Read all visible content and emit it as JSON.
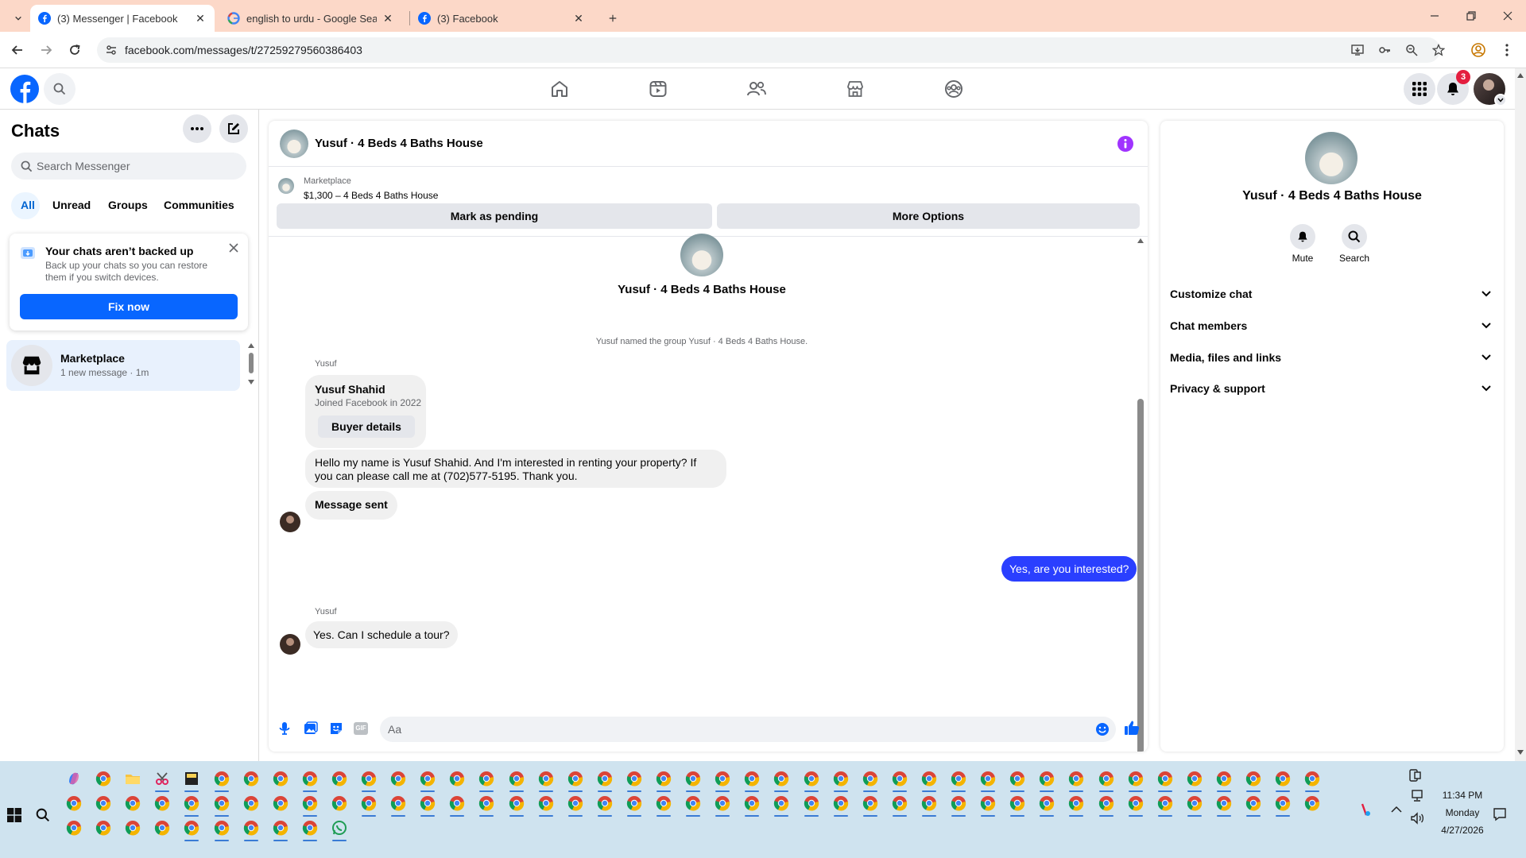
{
  "browser": {
    "tabs": [
      {
        "title": "(3) Messenger | Facebook",
        "icon": "facebook-icon",
        "active": true
      },
      {
        "title": "english to urdu - Google Search",
        "icon": "google-icon",
        "active": false
      },
      {
        "title": "(3) Facebook",
        "icon": "facebook-icon",
        "active": false
      }
    ],
    "url": "facebook.com/messages/t/27259279560386403"
  },
  "fb_header": {
    "notification_count": "3",
    "nav_icons": [
      "home-icon",
      "watch-icon",
      "friends-icon",
      "marketplace-icon",
      "groups-icon"
    ]
  },
  "sidebar": {
    "title": "Chats",
    "search_placeholder": "Search Messenger",
    "filters": [
      "All",
      "Unread",
      "Groups",
      "Communities"
    ],
    "backup": {
      "title": "Your chats aren’t backed up",
      "body": "Back up your chats so you can restore them if you switch devices.",
      "button": "Fix now"
    },
    "chats": [
      {
        "name": "Marketplace",
        "preview": "1 new message · 1m"
      }
    ]
  },
  "chat": {
    "title": "Yusuf · 4 Beds 4 Baths House",
    "listing_label": "Marketplace",
    "listing_price": "$1,300 – 4 Beds 4 Baths House",
    "pending_button": "Mark as pending",
    "more_button": "More Options",
    "group_name": "Yusuf · 4 Beds 4 Baths House",
    "system_msg": "Yusuf named the group Yusuf · 4 Beds 4 Baths House.",
    "sender_1": "Yusuf",
    "buyer_name": "Yusuf Shahid",
    "buyer_joined": "Joined Facebook in 2022",
    "buyer_button": "Buyer details",
    "msg_1": "Hello my name is Yusuf Shahid. And I'm interested in renting your property? If you can please call me at (702)577-5195. Thank you.",
    "msg_2": "Message sent",
    "msg_out": "Yes, are you interested?",
    "sender_2": "Yusuf",
    "msg_3": "Yes. Can I schedule a tour?",
    "composer_placeholder": "Aa"
  },
  "right_panel": {
    "title": "Yusuf · 4 Beds 4 Baths House",
    "mute_label": "Mute",
    "search_label": "Search",
    "sections": [
      "Customize chat",
      "Chat members",
      "Media, files and links",
      "Privacy & support"
    ]
  },
  "taskbar": {
    "time": "11:34 PM",
    "day": "Monday",
    "date": "4/27/2026"
  },
  "colors": {
    "fb_blue": "#0866ff",
    "messenger_purple": "#a033ff",
    "out_bubble": "#2a3fff",
    "notification_red": "#e41e3f"
  }
}
